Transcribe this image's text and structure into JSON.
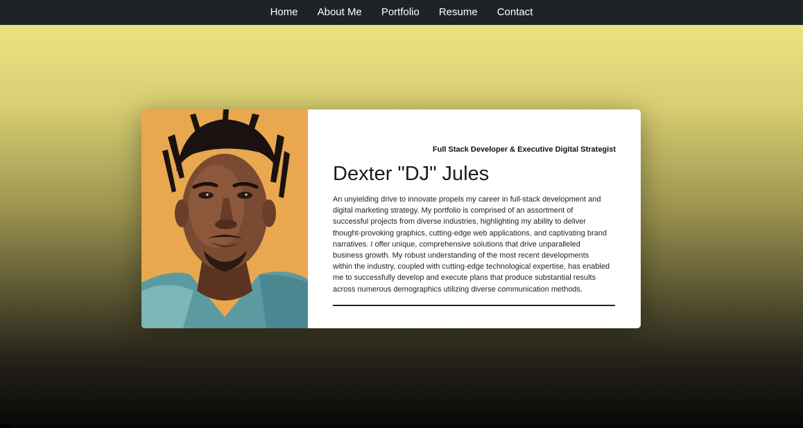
{
  "nav": {
    "links": [
      "Home",
      "About Me",
      "Portfolio",
      "Resume",
      "Contact"
    ]
  },
  "profile": {
    "subtitle": "Full Stack Developer & Executive Digital Strategist",
    "name": "Dexter \"DJ\" Jules",
    "bio": "An unyielding drive to innovate propels my career in full-stack development and digital marketing strategy. My portfolio is comprised of an assortment of successful projects from diverse industries, highlighting my ability to deliver thought-provoking graphics, cutting-edge web applications, and captivating brand narratives. I offer unique, comprehensive solutions that drive unparalleled business growth. My robust understanding of the most recent developments within the industry, coupled with cutting-edge technological expertise, has enabled me to successfully develop and execute plans that produce substantial results across numerous demographics utilizing diverse communication methods.",
    "portrait_icon": "profile-portrait"
  },
  "colors": {
    "nav_bg": "#1f2226",
    "gradient_top": "#ebe17f",
    "gradient_bottom": "#070705",
    "portrait_bg": "#e9a84f"
  }
}
